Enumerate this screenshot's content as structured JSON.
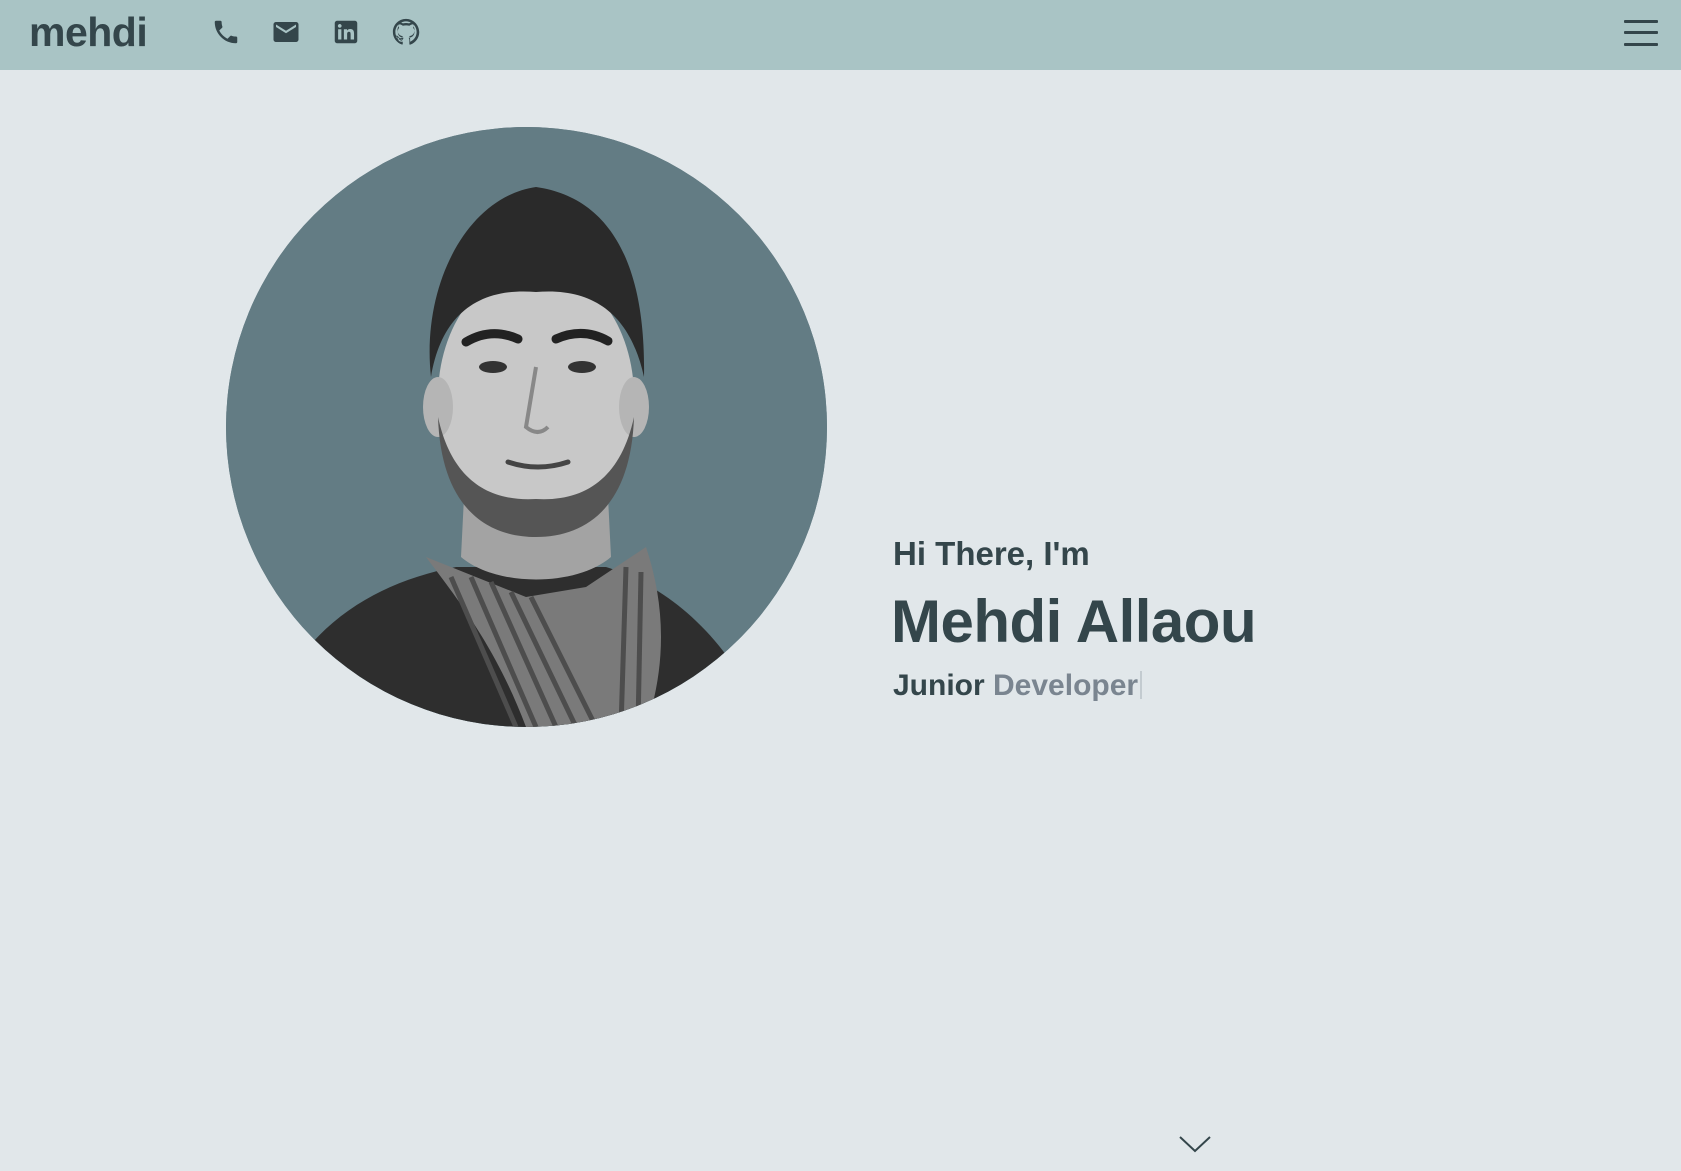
{
  "navbar": {
    "logo_text": "mehdi",
    "icons": [
      "phone-icon",
      "mail-icon",
      "linkedin-icon",
      "github-icon",
      "menu-icon"
    ],
    "background_color": "#a9c4c5"
  },
  "hero": {
    "greeting": "Hi There, I'm",
    "name": "Mehdi Allaou",
    "role_prefix": "Junior",
    "role_typed": "Developer",
    "avatar_background": "#637c84",
    "scroll_icon": "chevron-down-icon"
  },
  "colors": {
    "page_background": "#e1e7ea",
    "text_primary": "#34464b",
    "text_accent": "#7a8590"
  }
}
